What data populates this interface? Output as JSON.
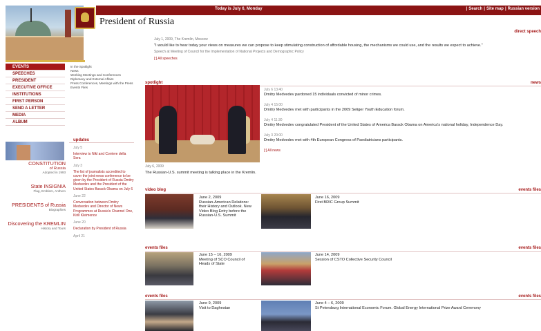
{
  "top_bar": {
    "date": "Today is July 6, Monday",
    "links": [
      "Search",
      "Site map",
      "Russian version"
    ]
  },
  "site": {
    "title": "President of Russia"
  },
  "menu": [
    {
      "label": "EVENTS",
      "active": true
    },
    {
      "label": "SPEECHES"
    },
    {
      "label": "PRESIDENT"
    },
    {
      "label": "EXECUTIVE OFFICE"
    },
    {
      "label": "INSTITUTIONS"
    },
    {
      "label": "FIRST PERSON"
    },
    {
      "label": "SEND A LETTER"
    },
    {
      "label": "MEDIA"
    },
    {
      "label": "ALBUM"
    }
  ],
  "submenu": [
    "In the Spotlight",
    "News",
    "Working Meetings and Conferences",
    "Diplomacy and External Affairs",
    "Press Conferences, Meetings with the Press",
    "Events Files"
  ],
  "side_links": [
    {
      "title": "CONSTITUTION",
      "title2": "of Russia",
      "sub": "Adopted in 1993"
    },
    {
      "title": "State INSIGNIA",
      "sub": "Flag, Emblem, Anthem"
    },
    {
      "title": "PRESIDENTS of Russia",
      "sub": "Biographies"
    },
    {
      "title": "Discovering the KREMLIN",
      "sub": "History and Tours"
    }
  ],
  "updates": {
    "header": "updates",
    "items": [
      {
        "date": "July 5",
        "text": "Interview to Nikl and Corriere della Sera"
      },
      {
        "date": "July 3",
        "text": "The list of journalists accredited to cover the joint news conference to be given by the President of Russia Dmitry Medvedev and the President of the United States Barack Obama on July 6"
      },
      {
        "date": "June 22",
        "text": "Conversation between Dmitry Medvedev and Director of News Programmes at Russia's Channel One, Kirill Kleimenov"
      },
      {
        "date": "June 20",
        "text": "Declaration by President of Russia"
      },
      {
        "date": "April 21",
        "text": ""
      }
    ]
  },
  "direct_speech": {
    "label": "direct speech",
    "date": "July 1, 2009, The Kremlin, Moscow",
    "quote": "\"I would like to hear today your views on measures we can propose to keep stimulating construction of affordable housing, the mechanisms we could use, and the results we expect to achieve.\"",
    "source": "Speech at Meeting of Council for the Implementation of National Projects and Demographic Policy",
    "all": "All speeches"
  },
  "spotlight": {
    "label": "spotlight",
    "date": "July 6, 2009",
    "text": "The Russian-U.S. summit meeting is talking place in the Kremlin."
  },
  "news": {
    "label": "news",
    "items": [
      {
        "date": "July 6 13:40",
        "text": "Dmitry Medvedev pardoned 15 individuals convicted of minor crimes."
      },
      {
        "date": "July 4 15:00",
        "text": "Dmitry Medvedev met with participants in the 2009 Seliger Youth Education forum."
      },
      {
        "date": "July 4 11:30",
        "text": "Dmitry Medvedev congratulated President of the United States of America Barack Obama on America's national holiday, Independence Day."
      },
      {
        "date": "July 3 20:00",
        "text": "Dmitry Medvedev met with 4th European Congress of Paediatricians participants."
      }
    ],
    "all": "All news"
  },
  "video_blog": {
    "label": "video blog",
    "right_label": "events files",
    "left": {
      "date": "June 2, 2009",
      "text": "Russian-American Relations: their History and Outlook. New Video Blog Entry before the Russian-U.S. Summit"
    },
    "right": {
      "date": "June 16, 2009",
      "text": "First BRIC Group Summit"
    }
  },
  "events_files_1": {
    "label": "events files",
    "right_label": "events files",
    "left": {
      "date": "June 15 – 16, 2009",
      "text": "Meeting of SCO Council of Heads of State"
    },
    "right": {
      "date": "June 14, 2009",
      "text": "Session of CSTO Collective Security Council"
    }
  },
  "events_files_2": {
    "label": "events files",
    "right_label": "events files",
    "left": {
      "date": "June 9, 2009",
      "text": "Visit to Daghestan"
    },
    "right": {
      "date": "June 4 – 6, 2009",
      "text": "St Petersburg International Economic Forum. Global Energy International Prize Award Ceremony"
    }
  }
}
